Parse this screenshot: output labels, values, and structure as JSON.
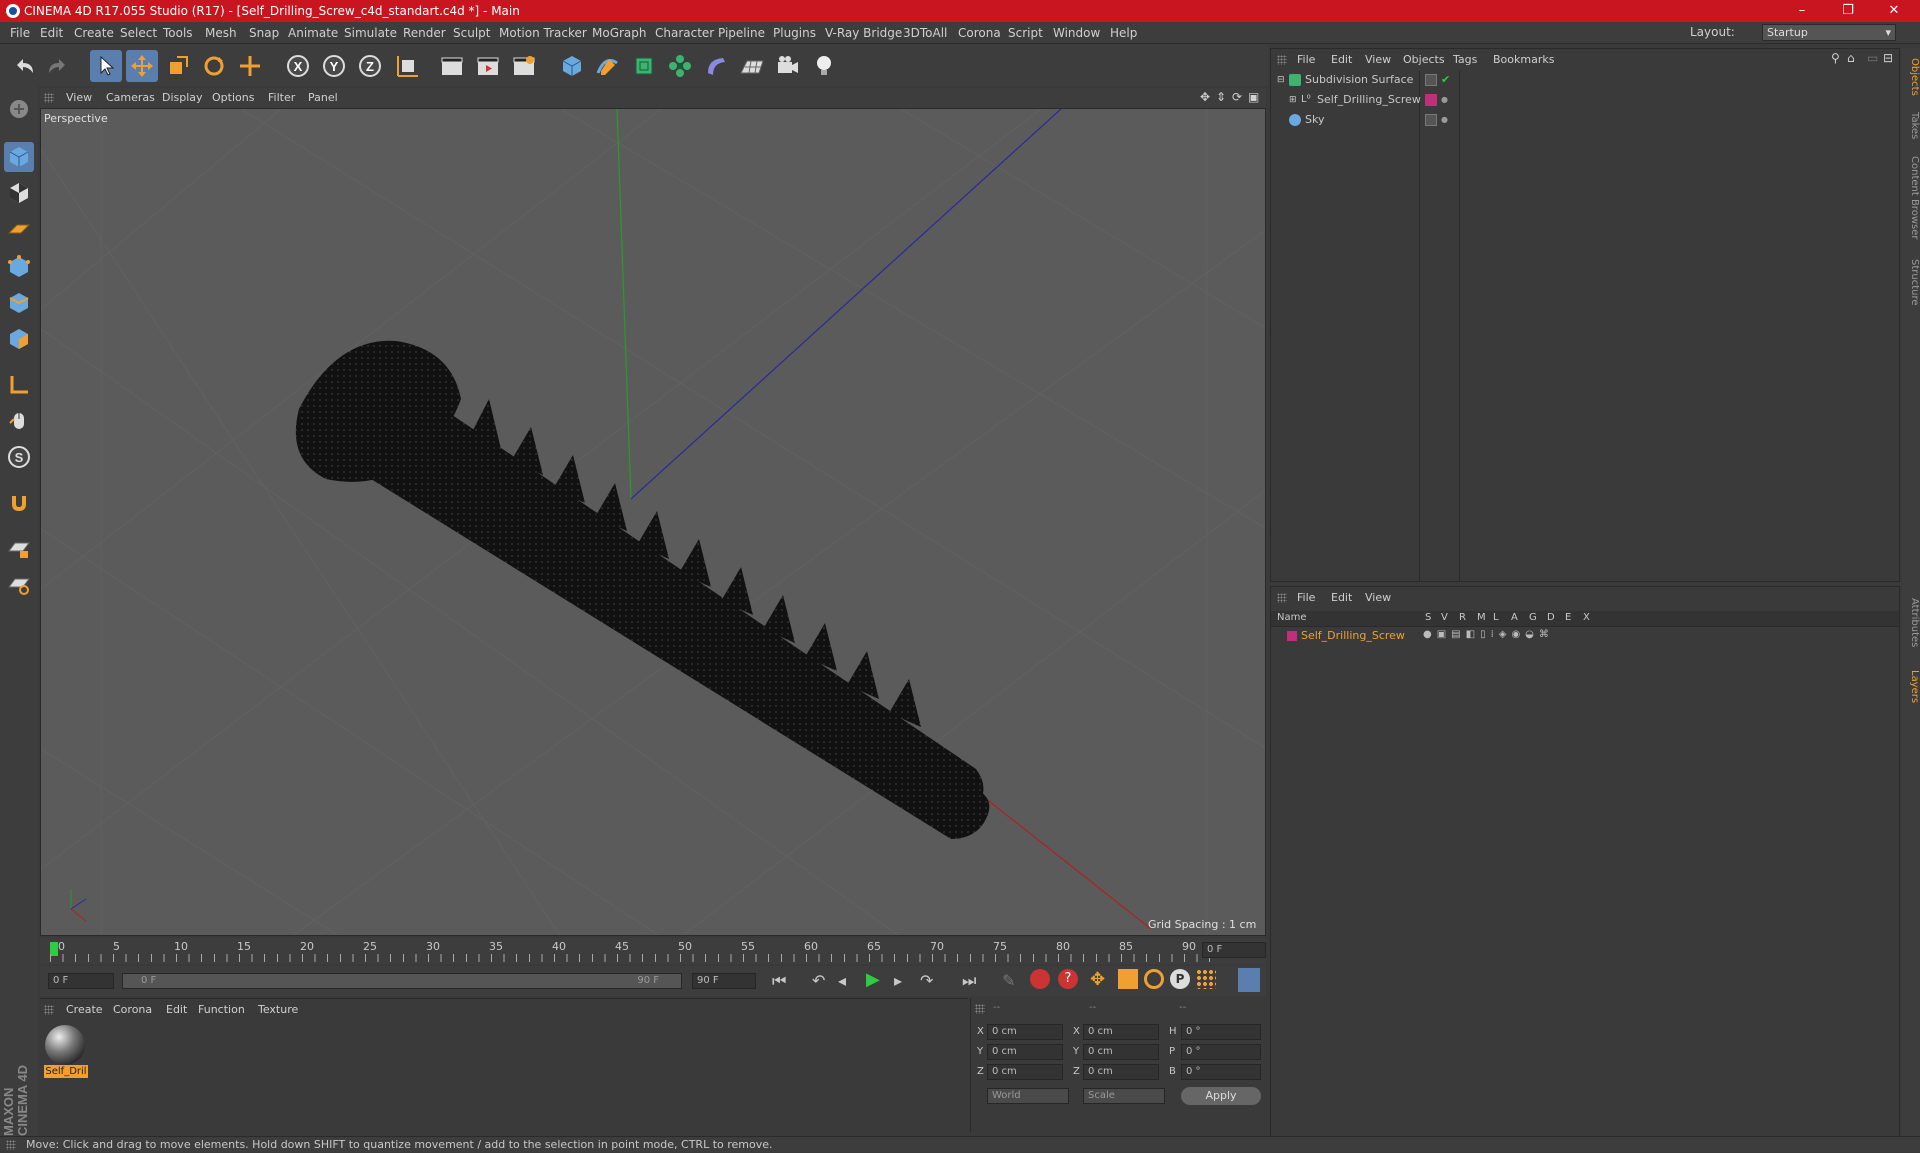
{
  "title_bar": {
    "title": "CINEMA 4D R17.055 Studio (R17) - [Self_Drilling_Screw_c4d_standart.c4d *] - Main",
    "minimize": "–",
    "maximize": "❐",
    "close": "✕"
  },
  "menu": [
    "File",
    "Edit",
    "Create",
    "Select",
    "Tools",
    "Mesh",
    "Snap",
    "Animate",
    "Simulate",
    "Render",
    "Sculpt",
    "Motion Tracker",
    "MoGraph",
    "Character",
    "Pipeline",
    "Plugins",
    "V-Ray Bridge",
    "3DToAll",
    "Corona",
    "Script",
    "Window",
    "Help"
  ],
  "layout": {
    "label": "Layout:",
    "value": "Startup"
  },
  "viewport": {
    "menu": [
      "View",
      "Cameras",
      "Display",
      "Options",
      "Filter",
      "Panel"
    ],
    "camera_label": "Perspective",
    "grid_spacing": "Grid Spacing : 1 cm"
  },
  "timeline": {
    "ticks": [
      "0",
      "5",
      "10",
      "15",
      "20",
      "25",
      "30",
      "35",
      "40",
      "45",
      "50",
      "55",
      "60",
      "65",
      "70",
      "75",
      "80",
      "85",
      "90"
    ],
    "current_frame": "0 F",
    "start_field": "0 F",
    "range_start": "0 F",
    "range_end": "90 F",
    "end_field": "90 F"
  },
  "material_panel": {
    "menu": [
      "Create",
      "Corona",
      "Edit",
      "Function",
      "Texture"
    ],
    "material_name": "Self_Dril"
  },
  "coord_panel": {
    "headers": [
      "--",
      "--",
      "--"
    ],
    "rows": [
      {
        "a": "X",
        "av": "0 cm",
        "b": "X",
        "bv": "0 cm",
        "c": "H",
        "cv": "0 °"
      },
      {
        "a": "Y",
        "av": "0 cm",
        "b": "Y",
        "bv": "0 cm",
        "c": "P",
        "cv": "0 °"
      },
      {
        "a": "Z",
        "av": "0 cm",
        "b": "Z",
        "bv": "0 cm",
        "c": "B",
        "cv": "0 °"
      }
    ],
    "world": "World",
    "scale": "Scale",
    "apply": "Apply"
  },
  "object_manager": {
    "menu": [
      "File",
      "Edit",
      "View",
      "Objects",
      "Tags",
      "Bookmarks"
    ],
    "objects": [
      {
        "name": "Subdivision Surface",
        "indent": 0
      },
      {
        "name": "Self_Drilling_Screw",
        "indent": 1
      },
      {
        "name": "Sky",
        "indent": 0
      }
    ]
  },
  "layer_manager": {
    "menu": [
      "File",
      "Edit",
      "View"
    ],
    "columns": [
      "Name",
      "S",
      "V",
      "R",
      "M",
      "L",
      "A",
      "G",
      "D",
      "E",
      "X"
    ],
    "layer": "Self_Drilling_Screw"
  },
  "right_tabs": [
    "Objects",
    "Takes",
    "Content Browser",
    "Structure",
    "Attributes",
    "Layers"
  ],
  "status": "Move: Click and drag to move elements. Hold down SHIFT to quantize movement / add to the selection in point mode, CTRL to remove.",
  "brand": "MAXON CINEMA 4D",
  "colors": {
    "title_red": "#c8151f",
    "highlight_blue": "#5a7fae",
    "layer_pink": "#c0307a",
    "accent_orange": "#f0a030"
  }
}
